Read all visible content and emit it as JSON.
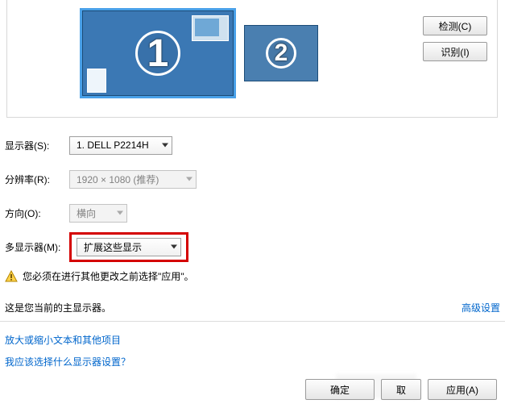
{
  "monitors": {
    "primary_num": "1",
    "secondary_num": "2"
  },
  "buttons": {
    "detect": "检测(C)",
    "identify": "识别(I)",
    "ok": "确定",
    "cancel": "取",
    "apply": "应用(A)"
  },
  "labels": {
    "display": "显示器(S):",
    "resolution": "分辨率(R):",
    "orientation": "方向(O):",
    "multi": "多显示器(M):"
  },
  "values": {
    "display": "1. DELL P2214H",
    "resolution": "1920 × 1080 (推荐)",
    "orientation": "横向",
    "multi": "扩展这些显示"
  },
  "warning": "您必须在进行其他更改之前选择\"应用\"。",
  "primary_note": "这是您当前的主显示器。",
  "links": {
    "advanced": "高级设置",
    "text_size": "放大或缩小文本和其他项目",
    "which_settings": "我应该选择什么显示器设置？"
  }
}
